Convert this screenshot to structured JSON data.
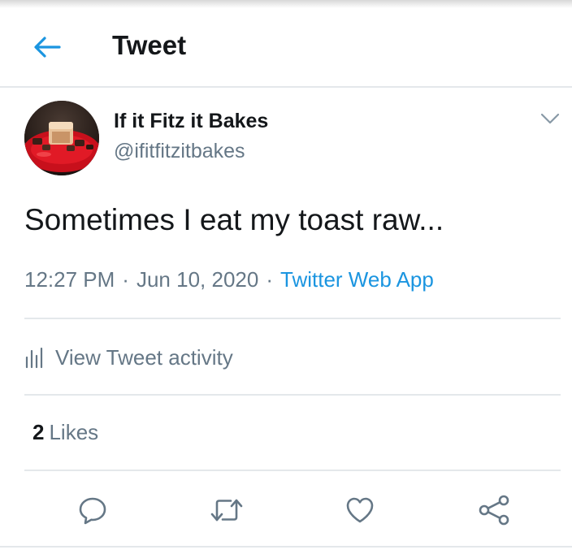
{
  "header": {
    "back_icon": "arrow-left-icon",
    "title": "Tweet"
  },
  "colors": {
    "accent": "#1b95e0",
    "text_primary": "#14171a",
    "text_secondary": "#657786",
    "divider": "#e4e8eb"
  },
  "tweet": {
    "display_name": "If it Fitz it Bakes",
    "handle": "@ifitfitzitbakes",
    "text": "Sometimes I eat my toast raw...",
    "time": "12:27 PM",
    "date": "Jun 10, 2020",
    "separator": "·",
    "source": "Twitter Web App",
    "options_icon": "chevron-down-icon",
    "avatar_icon": "cake-on-red-plate-avatar"
  },
  "activity": {
    "icon": "bar-chart-icon",
    "label": "View Tweet activity"
  },
  "stats": {
    "likes_count": "2",
    "likes_label": "Likes"
  },
  "actions": [
    {
      "name": "reply",
      "icon": "reply-icon"
    },
    {
      "name": "retweet",
      "icon": "retweet-icon"
    },
    {
      "name": "like",
      "icon": "heart-icon"
    },
    {
      "name": "share",
      "icon": "share-icon"
    }
  ]
}
